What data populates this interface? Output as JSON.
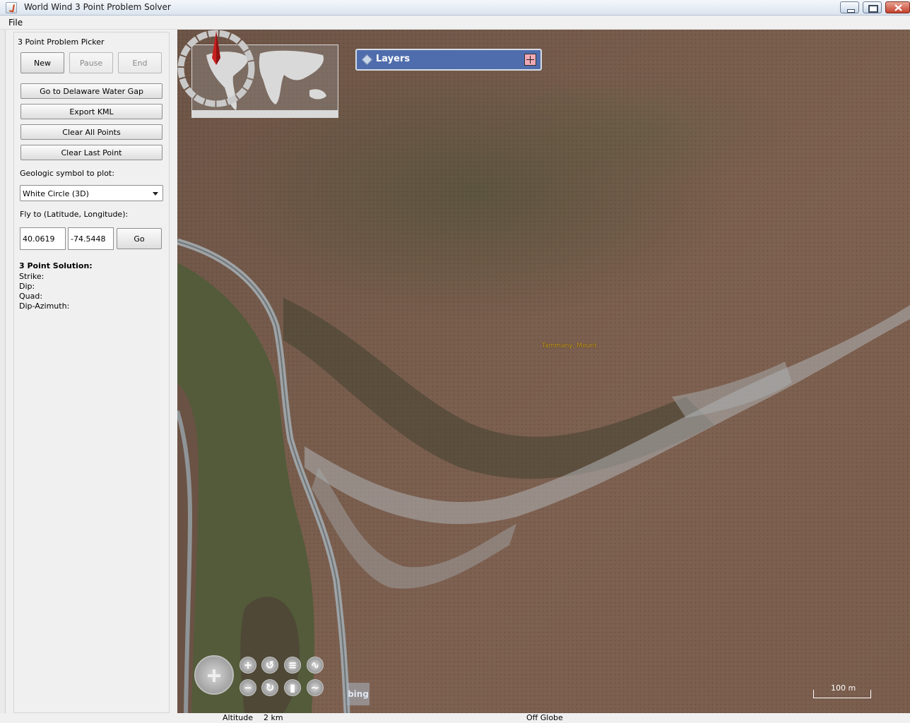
{
  "window": {
    "title": "World Wind 3 Point Problem Solver"
  },
  "menu": {
    "file": "File"
  },
  "panel": {
    "title": "3 Point Problem Picker",
    "new_label": "New",
    "pause_label": "Pause",
    "end_label": "End",
    "goto_label": "Go to Delaware Water Gap",
    "export_label": "Export KML",
    "clear_all_label": "Clear All Points",
    "clear_last_label": "Clear Last Point",
    "symbol_label": "Geologic symbol to plot:",
    "symbol_selected": "White Circle (3D)",
    "fly_label": "Fly to (Latitude, Longitude):",
    "latitude": "40.0619",
    "longitude": "-74.5448",
    "go_label": "Go",
    "solution_title": "3 Point Solution:",
    "strike_label": "Strike:",
    "dip_label": "Dip:",
    "quad_label": "Quad:",
    "dip_azimuth_label": "Dip-Azimuth:"
  },
  "map": {
    "layers_label": "Layers",
    "place_name": "Tammany, Mount",
    "scale_label": "100 m",
    "bing_label": "bing",
    "accent": "#4f6dad",
    "place_color": "#d4a420"
  },
  "status": {
    "altitude_label": "Altitude",
    "altitude_value": "2 km",
    "position_text": "Off Globe"
  }
}
